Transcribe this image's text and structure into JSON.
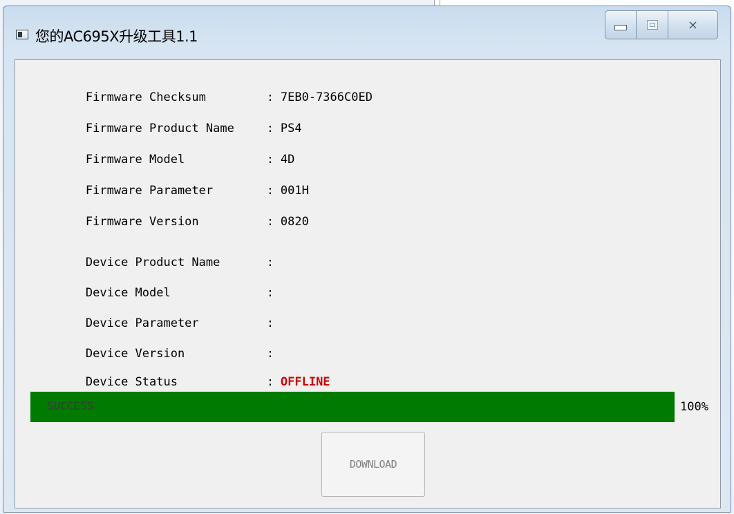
{
  "window": {
    "title": "您的AC695X升级工具1.1",
    "icon": "app-window-icon",
    "buttons": {
      "minimize": "minimize-icon",
      "maximize": "maximize-icon",
      "close": "close-icon"
    }
  },
  "fields": [
    {
      "label": "Firmware Checksum",
      "colon": ":",
      "value": "7EB0-7366C0ED"
    },
    {
      "label": "Firmware Product Name",
      "colon": ":",
      "value": "PS4"
    },
    {
      "label": "Firmware Model",
      "colon": ":",
      "value": "4D"
    },
    {
      "label": "Firmware Parameter",
      "colon": ":",
      "value": "001H"
    },
    {
      "label": "Firmware Version",
      "colon": ":",
      "value": "0820"
    },
    {
      "label": "Device Product Name",
      "colon": ":",
      "value": ""
    },
    {
      "label": "Device Model",
      "colon": ":",
      "value": ""
    },
    {
      "label": "Device Parameter",
      "colon": ":",
      "value": ""
    },
    {
      "label": "Device Version",
      "colon": ":",
      "value": ""
    },
    {
      "label": "Device Status",
      "colon": ":",
      "value": "OFFLINE"
    }
  ],
  "progress": {
    "label": "SUCCESS",
    "percent_text": "100%",
    "fraction": 1.0,
    "color": "#007a00"
  },
  "download_button": {
    "label": "DOWNLOAD",
    "enabled": false
  },
  "colors": {
    "status_offline": "#d00000"
  }
}
